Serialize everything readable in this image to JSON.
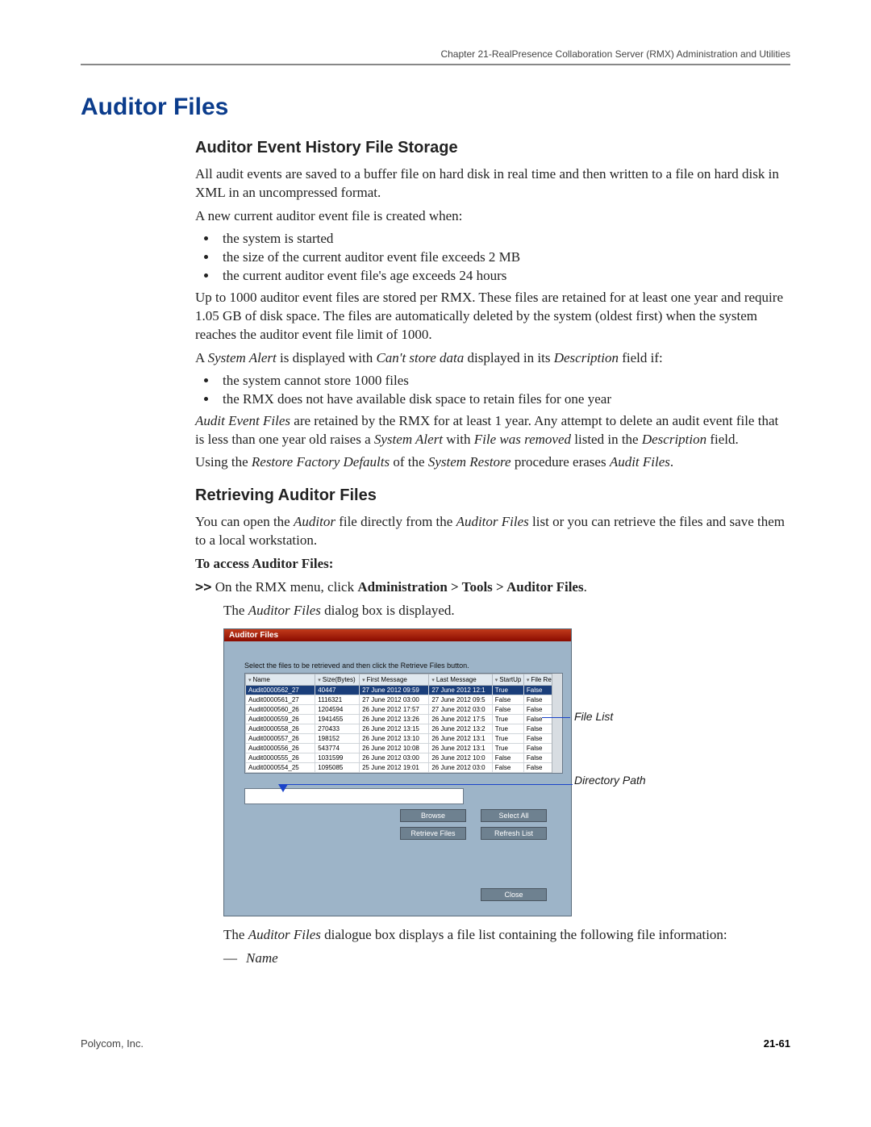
{
  "header": {
    "chapter": "Chapter 21-RealPresence Collaboration Server (RMX) Administration and Utilities"
  },
  "h1": "Auditor Files",
  "s1": {
    "h2": "Auditor Event History File Storage",
    "p1": "All audit events are saved to a buffer file on hard disk in real time and then written to a file on hard disk in XML in an uncompressed format.",
    "p2": "A new current auditor event file is created when:",
    "bul1": [
      "the system is started",
      "the size of the current auditor event file exceeds 2 MB",
      "the current auditor event file's age exceeds 24 hours"
    ],
    "p3": "Up to 1000 auditor event files are stored per RMX. These files are retained for at least one year and require 1.05 GB of disk space. The files are automatically deleted by the system (oldest first) when the system reaches the auditor event file limit of 1000.",
    "p4_pre": "A ",
    "p4_i1": "System Alert",
    "p4_mid1": " is displayed with ",
    "p4_i2": "Can't store data",
    "p4_mid2": " displayed in its ",
    "p4_i3": "Description",
    "p4_post": " field if:",
    "bul2": [
      "the system cannot store 1000 files",
      "the RMX does not have available disk space to retain files for one year"
    ],
    "p5_i1": "Audit Event Files",
    "p5_mid1": " are retained by the RMX for at least 1 year. Any attempt to delete an audit event file that is less than one year old raises a ",
    "p5_i2": "System Alert",
    "p5_mid2": " with ",
    "p5_i3": "File was removed",
    "p5_mid3": " listed in the ",
    "p5_i4": "Description",
    "p5_post": " field.",
    "p6_pre": "Using the ",
    "p6_i1": "Restore Factory Defaults",
    "p6_mid1": " of the ",
    "p6_i2": "System Restore",
    "p6_mid2": " procedure erases ",
    "p6_i3": "Audit Files",
    "p6_post": "."
  },
  "s2": {
    "h2": "Retrieving Auditor Files",
    "p1_pre": "You can open the ",
    "p1_i1": "Auditor",
    "p1_mid": " file directly from the ",
    "p1_i2": "Auditor Files",
    "p1_post": " list or you can retrieve the files and save them to a local workstation.",
    "p2": "To access Auditor Files:",
    "step_arrow": ">>",
    "step_pre": "On the RMX menu, click ",
    "step_bold": "Administration > Tools > Auditor Files",
    "step_post": ".",
    "step_result_pre": "The ",
    "step_result_i": "Auditor Files",
    "step_result_post": " dialog box is displayed.",
    "p_after_pre": "The ",
    "p_after_i": "Auditor Files",
    "p_after_post": " dialogue box displays a file list containing the following file information:",
    "dash_item": "Name"
  },
  "dialog": {
    "title": "Auditor Files",
    "instr": "Select the files to be retrieved and then click the Retrieve Files button.",
    "columns": [
      "Name",
      "Size(Bytes)",
      "First Message",
      "Last Message",
      "StartUp",
      "File Retrieved"
    ],
    "rows": [
      {
        "sel": true,
        "c": [
          "Audit0000562_27",
          "40447",
          "27 June 2012 09:59",
          "27 June 2012 12:1",
          "True",
          "False"
        ]
      },
      {
        "sel": false,
        "c": [
          "Audit0000561_27",
          "1116321",
          "27 June 2012 03:00",
          "27 June 2012 09:5",
          "False",
          "False"
        ]
      },
      {
        "sel": false,
        "c": [
          "Audit0000560_26",
          "1204594",
          "26 June 2012 17:57",
          "27 June 2012 03:0",
          "False",
          "False"
        ]
      },
      {
        "sel": false,
        "c": [
          "Audit0000559_26",
          "1941455",
          "26 June 2012 13:26",
          "26 June 2012 17:5",
          "True",
          "False"
        ]
      },
      {
        "sel": false,
        "c": [
          "Audit0000558_26",
          "270433",
          "26 June 2012 13:15",
          "26 June 2012 13:2",
          "True",
          "False"
        ]
      },
      {
        "sel": false,
        "c": [
          "Audit0000557_26",
          "198152",
          "26 June 2012 13:10",
          "26 June 2012 13:1",
          "True",
          "False"
        ]
      },
      {
        "sel": false,
        "c": [
          "Audit0000556_26",
          "543774",
          "26 June 2012 10:08",
          "26 June 2012 13:1",
          "True",
          "False"
        ]
      },
      {
        "sel": false,
        "c": [
          "Audit0000555_26",
          "1031599",
          "26 June 2012 03:00",
          "26 June 2012 10:0",
          "False",
          "False"
        ]
      },
      {
        "sel": false,
        "c": [
          "Audit0000554_25",
          "1095085",
          "25 June 2012 19:01",
          "26 June 2012 03:0",
          "False",
          "False"
        ]
      }
    ],
    "buttons": {
      "browse": "Browse",
      "select_all": "Select All",
      "retrieve": "Retrieve Files",
      "refresh": "Refresh List",
      "close": "Close"
    },
    "annot_filelist": "File List",
    "annot_dirpath": "Directory Path"
  },
  "footer": {
    "left": "Polycom, Inc.",
    "page": "21-61"
  }
}
